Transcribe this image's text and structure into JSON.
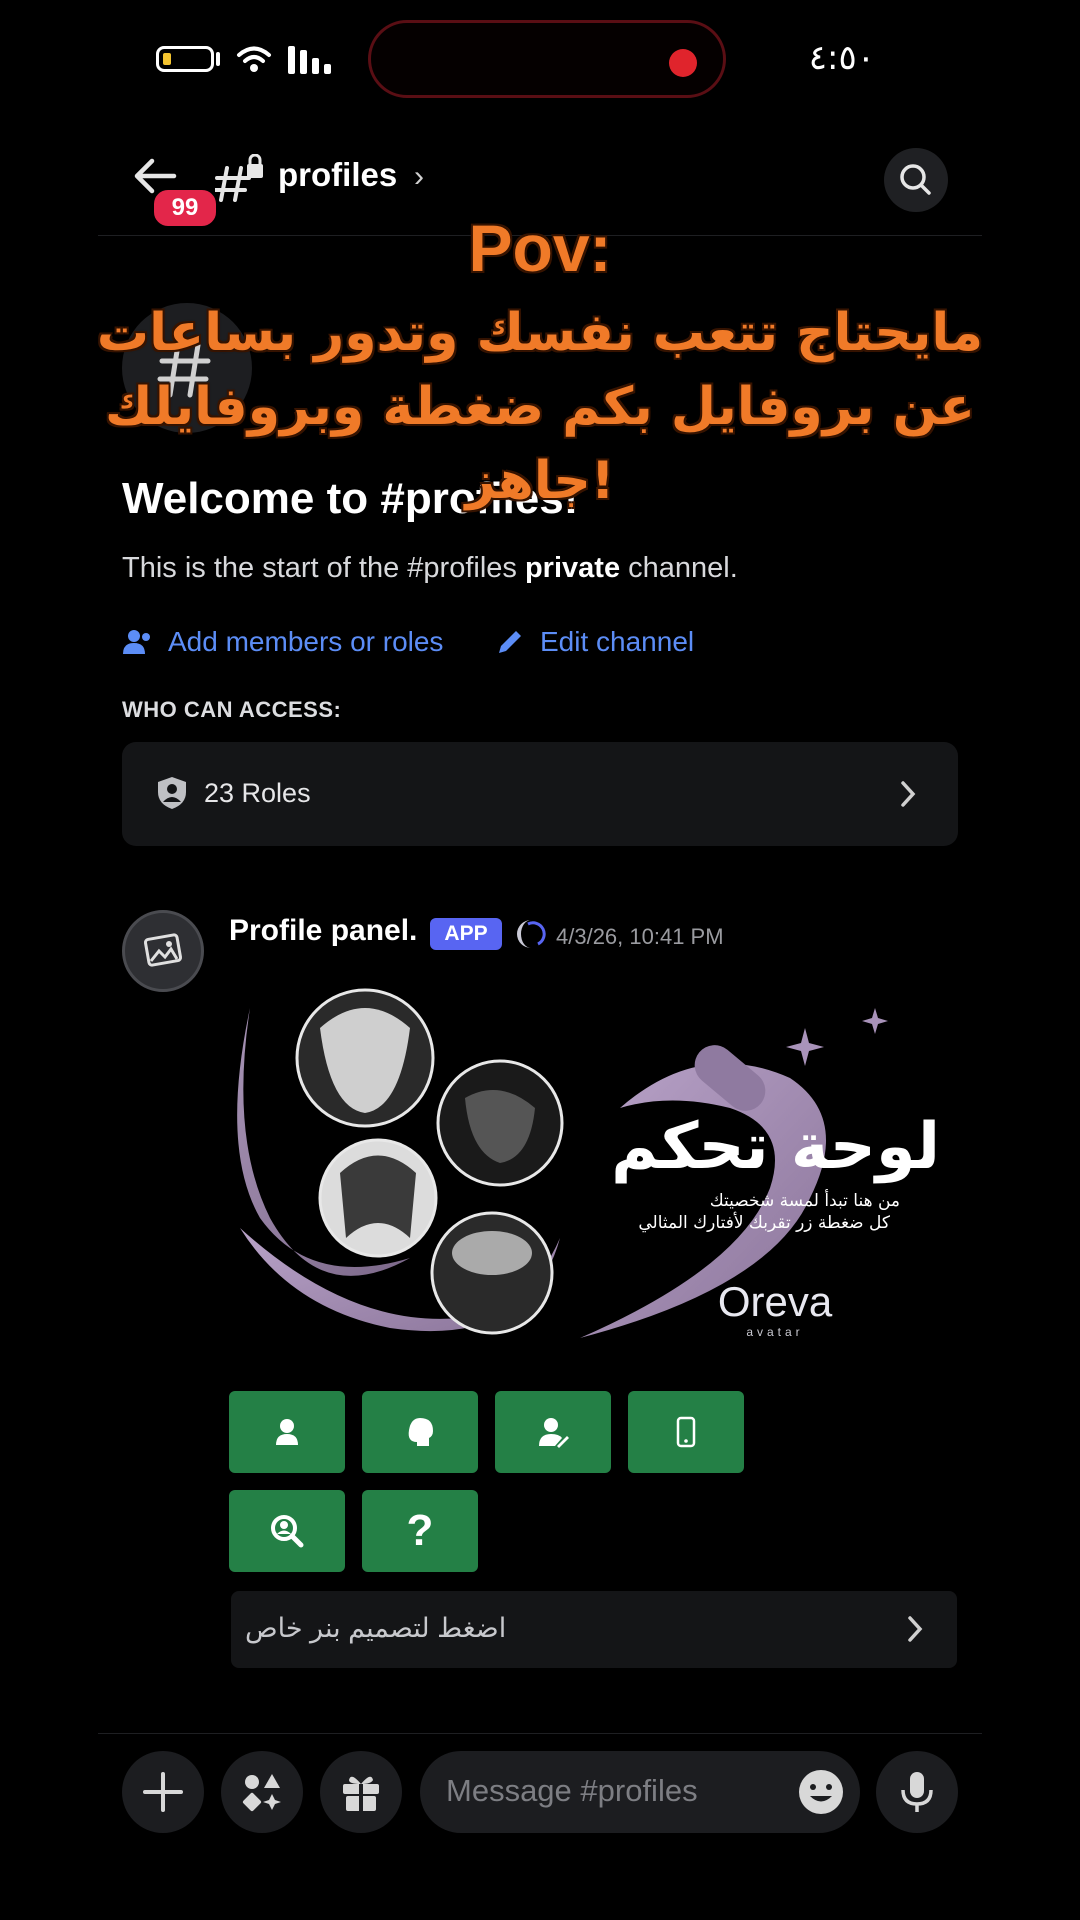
{
  "status_bar": {
    "time": "٤:٥٠"
  },
  "header": {
    "unread_badge": "99",
    "channel_name": "profiles",
    "chevron": "›"
  },
  "overlay": {
    "line1": "Pov:",
    "line2": "مايحتاج تتعب نفسك وتدور بساعات",
    "line3": "عن بروفايل بكم ضغطة وبروفايلك",
    "line4": "جاهز!"
  },
  "welcome": {
    "title": "Welcome to #profiles!",
    "subtitle_start": "This is the start of the #profiles ",
    "subtitle_bold": "private",
    "subtitle_end": " channel.",
    "add_members_label": "Add members or roles",
    "edit_channel_label": "Edit channel",
    "access_heading": "WHO CAN ACCESS:",
    "roles_label": "23 Roles"
  },
  "message": {
    "author": "Profile panel.",
    "app_tag": "APP",
    "timestamp": "4/3/26, 10:41 PM",
    "banner": {
      "title": "لوحة تحكم",
      "line1": "من هنا تبدأ لمسة شخصيتك",
      "line2": "كل ضغطة زر تقربك لأفتارك المثالي",
      "brand": "Oreva",
      "brand_sub": "avatar"
    },
    "buttons": [
      {
        "icon": "person-icon"
      },
      {
        "icon": "head-profile-icon"
      },
      {
        "icon": "user-design-icon"
      },
      {
        "icon": "phone-icon"
      },
      {
        "icon": "search-user-icon"
      },
      {
        "icon": "question-icon",
        "label": "?"
      }
    ],
    "select_placeholder": "اضغط لتصميم بنر خاص"
  },
  "composer": {
    "placeholder": "Message #profiles"
  },
  "colors": {
    "accent_blue": "#5865f2",
    "link_blue": "#5c8df6",
    "button_green": "#248046",
    "badge_red": "#e3264a",
    "overlay_orange": "#f07a28"
  }
}
